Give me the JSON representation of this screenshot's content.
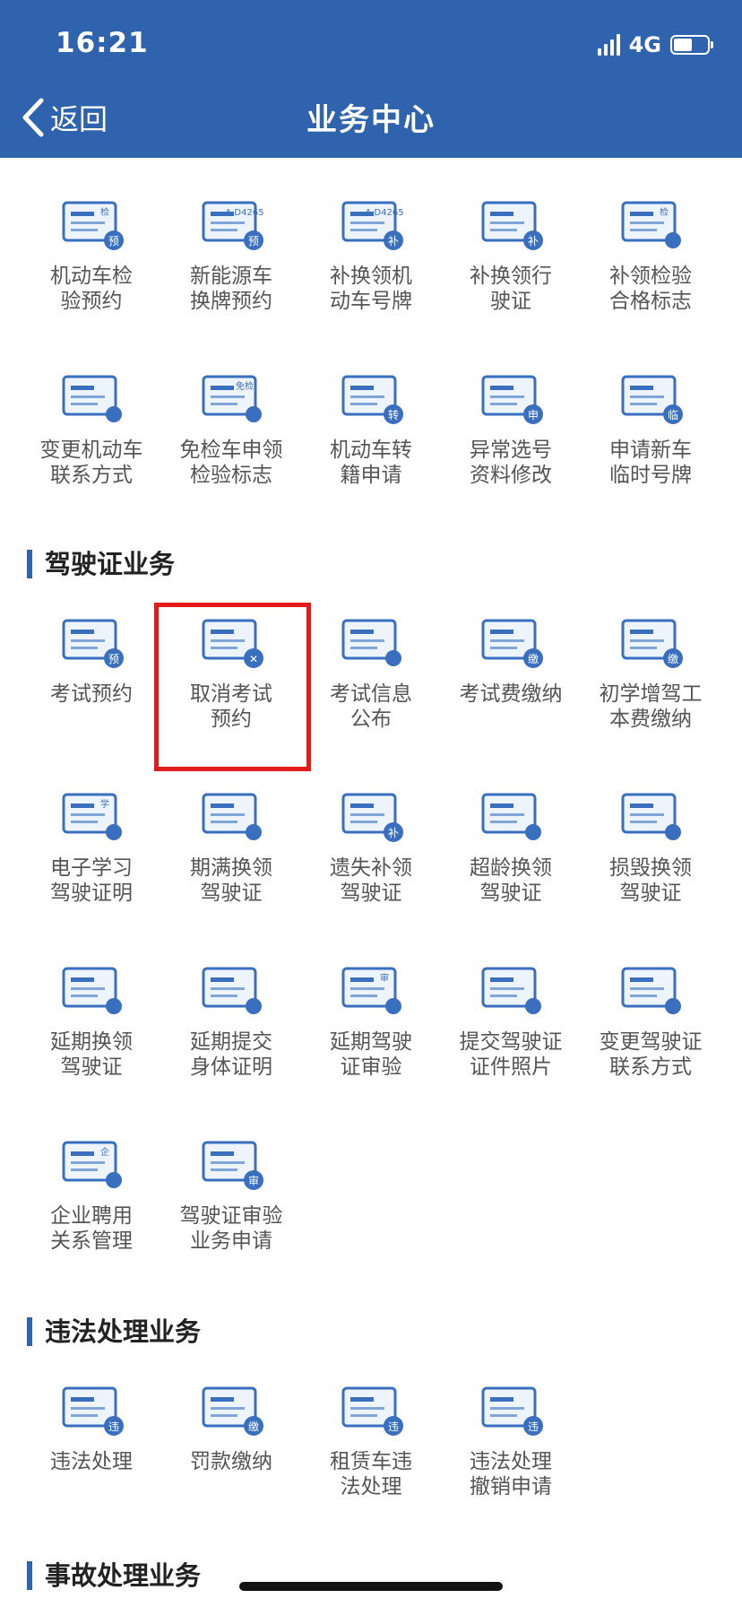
{
  "status_bar": {
    "time": "16:21",
    "network": "4G"
  },
  "nav": {
    "back_label": "返回",
    "title": "业务中心"
  },
  "sections": [
    {
      "title": ""
    },
    {
      "title": "驾驶证业务"
    },
    {
      "title": "违法处理业务"
    },
    {
      "title": "事故处理业务"
    }
  ],
  "vehicle_items": [
    {
      "label": "机动车检\n验预约",
      "badge": "预",
      "tag": "检"
    },
    {
      "label": "新能源车\n换牌预约",
      "badge": "预",
      "tag": "A·D4265"
    },
    {
      "label": "补换领机\n动车号牌",
      "badge": "补",
      "tag": "A·D4265"
    },
    {
      "label": "补换领行\n驶证",
      "badge": "补"
    },
    {
      "label": "补领检验\n合格标志",
      "tag": "检"
    },
    {
      "label": "变更机动车\n联系方式"
    },
    {
      "label": "免检车申领\n检验标志",
      "tag": "免检"
    },
    {
      "label": "机动车转\n籍申请",
      "badge": "转"
    },
    {
      "label": "异常选号\n资料修改",
      "badge": "申"
    },
    {
      "label": "申请新车\n临时号牌",
      "badge": "临"
    }
  ],
  "license_items": [
    {
      "label": "考试预约",
      "badge": "预"
    },
    {
      "label": "取消考试\n预约",
      "badge": "✕"
    },
    {
      "label": "考试信息\n公布"
    },
    {
      "label": "考试费缴纳",
      "badge": "缴"
    },
    {
      "label": "初学增驾工\n本费缴纳",
      "badge": "缴"
    },
    {
      "label": "电子学习\n驾驶证明",
      "tag": "学"
    },
    {
      "label": "期满换领\n驾驶证"
    },
    {
      "label": "遗失补领\n驾驶证",
      "badge": "补"
    },
    {
      "label": "超龄换领\n驾驶证"
    },
    {
      "label": "损毁换领\n驾驶证"
    },
    {
      "label": "延期换领\n驾驶证"
    },
    {
      "label": "延期提交\n身体证明"
    },
    {
      "label": "延期驾驶\n证审验",
      "tag": "审"
    },
    {
      "label": "提交驾驶证\n证件照片"
    },
    {
      "label": "变更驾驶证\n联系方式"
    },
    {
      "label": "企业聘用\n关系管理",
      "tag": "企"
    },
    {
      "label": "驾驶证审验\n业务申请",
      "badge": "审"
    }
  ],
  "violation_items": [
    {
      "label": "违法处理",
      "badge": "违"
    },
    {
      "label": "罚款缴纳",
      "badge": "缴"
    },
    {
      "label": "租赁车违\n法处理",
      "badge": "违"
    },
    {
      "label": "违法处理\n撤销申请",
      "badge": "违"
    }
  ],
  "colors": {
    "header": "#2f63ad",
    "icon_stroke": "#3a6fbf",
    "highlight": "#e31b1b"
  }
}
